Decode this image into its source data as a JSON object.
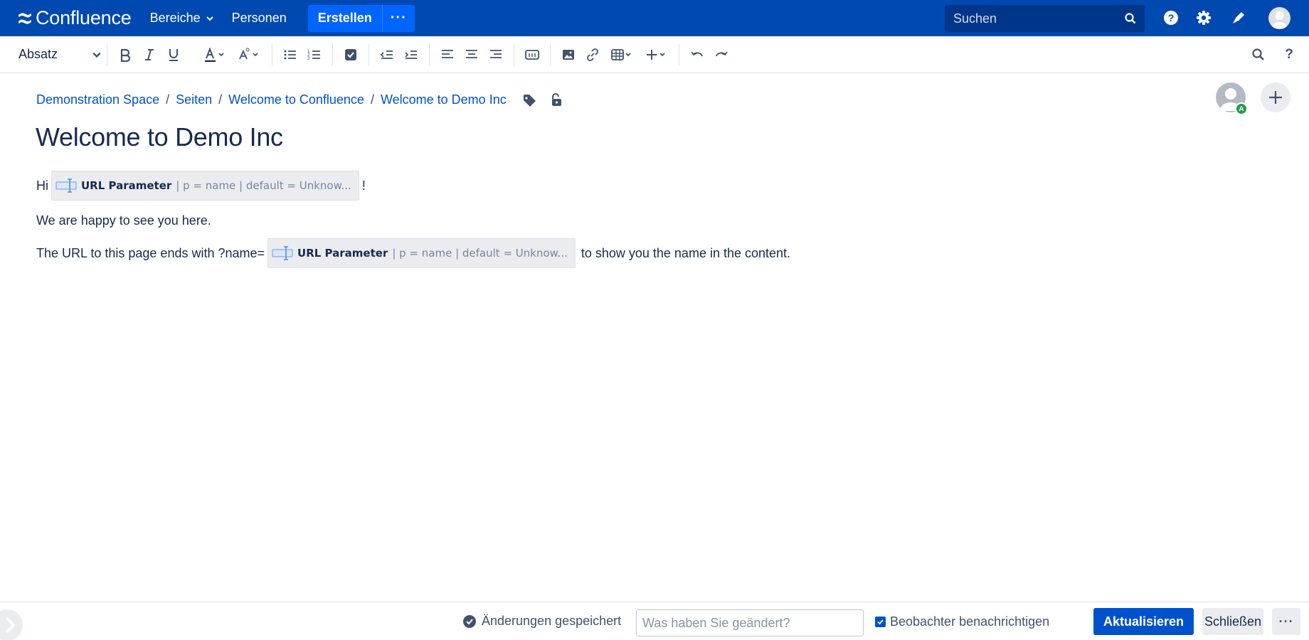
{
  "colors": {
    "nav_bg": "#0049b0",
    "accent": "#0052cc",
    "create_btn": "#0065ff",
    "text": "#172b4d"
  },
  "topnav": {
    "logo_text": "Confluence",
    "links": [
      {
        "label": "Bereiche",
        "has_dropdown": true
      },
      {
        "label": "Personen",
        "has_dropdown": false
      }
    ],
    "create_label": "Erstellen",
    "more_label": "···",
    "search_placeholder": "Suchen",
    "icons": [
      "help-icon",
      "settings-icon",
      "notifications-icon",
      "user-avatar"
    ]
  },
  "toolbar": {
    "paragraph_style": "Absatz",
    "buttons": [
      "bold",
      "italic",
      "underline",
      "text-color",
      "text-format",
      "bullet-list",
      "numbered-list",
      "task-list",
      "outdent",
      "indent",
      "align-left",
      "align-center",
      "align-right",
      "page-layout",
      "image",
      "link",
      "table",
      "insert-more",
      "undo",
      "redo",
      "find",
      "help"
    ]
  },
  "breadcrumbs": [
    "Demonstration Space",
    "Seiten",
    "Welcome to Confluence",
    "Welcome to Demo Inc"
  ],
  "page": {
    "title": "Welcome to Demo Inc",
    "line1_before": "Hi",
    "line1_after": "!",
    "line2": "We are happy to see you here.",
    "line3_before": "The URL to this page ends with ?name=",
    "line3_after": "to show you the name in the content.",
    "macro": {
      "name": "URL Parameter",
      "params": "| p = name | default = Unknow..."
    },
    "avatar_badge": "A"
  },
  "footer": {
    "saved_text": "Änderungen gespeichert",
    "change_placeholder": "Was haben Sie geändert?",
    "change_value": "",
    "notify_watchers_label": "Beobachter benachrichtigen",
    "notify_watchers_checked": true,
    "update_label": "Aktualisieren",
    "close_label": "Schließen",
    "more_label": "···"
  }
}
